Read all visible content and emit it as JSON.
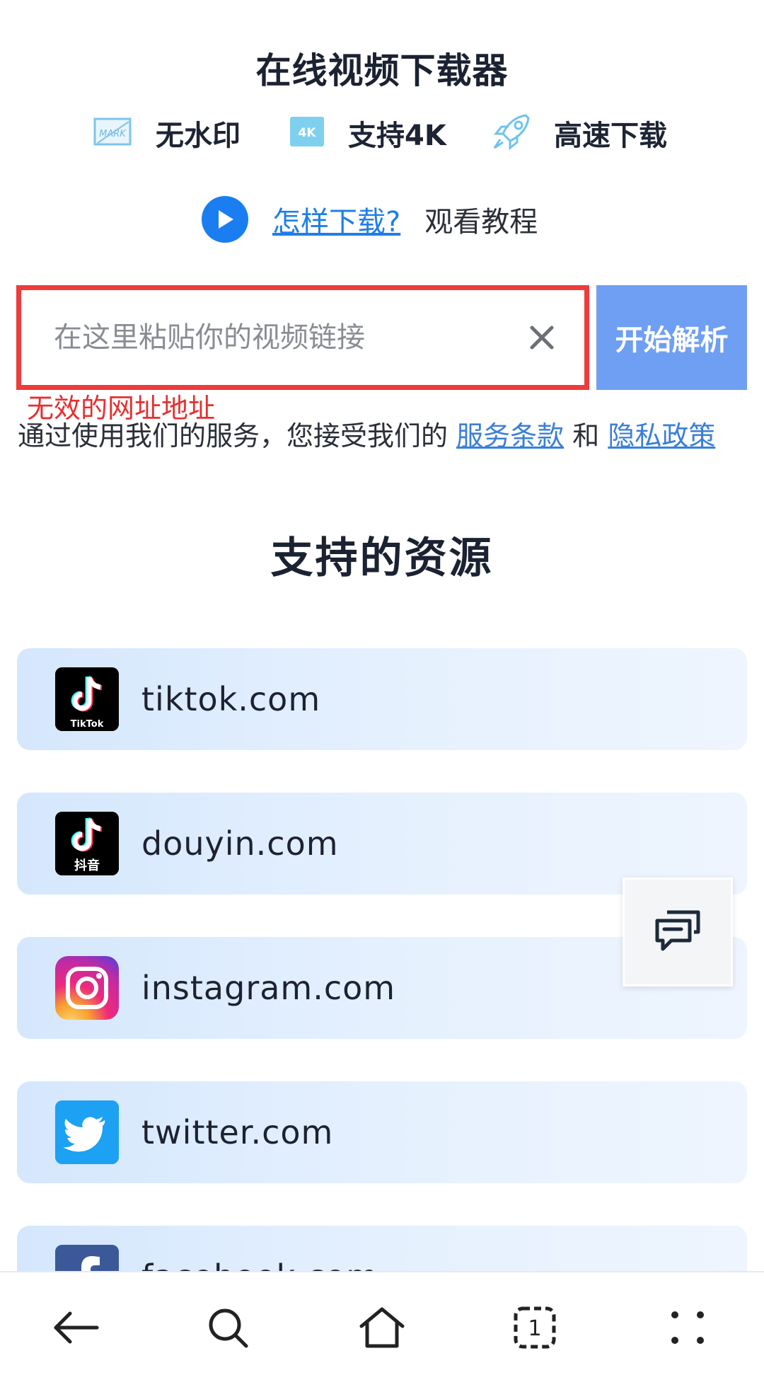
{
  "header": {
    "title": "在线视频下载器"
  },
  "features": [
    {
      "icon": "watermark-icon",
      "label": "无水印"
    },
    {
      "icon": "4k-icon",
      "label": "支持4K"
    },
    {
      "icon": "rocket-icon",
      "label": "高速下载"
    }
  ],
  "howto": {
    "link_text": "怎样下载?",
    "suffix_text": "观看教程"
  },
  "search": {
    "placeholder": "在这里粘贴你的视频链接",
    "value": "",
    "button_label": "开始解析"
  },
  "error_text": "无效的网址地址",
  "terms": {
    "prefix": "通过使用我们的服务，您接受我们的",
    "service_link": "服务条款",
    "conjunction": "和",
    "privacy_link": "隐私政策"
  },
  "sources": {
    "title": "支持的资源",
    "items": [
      {
        "name": "tiktok.com",
        "icon": "tiktok-icon",
        "logo_text": "TikTok"
      },
      {
        "name": "douyin.com",
        "icon": "douyin-icon",
        "logo_text": "抖音"
      },
      {
        "name": "instagram.com",
        "icon": "instagram-icon"
      },
      {
        "name": "twitter.com",
        "icon": "twitter-icon"
      },
      {
        "name": "facebook.com",
        "icon": "facebook-icon"
      }
    ]
  },
  "bottom_nav": {
    "items": [
      "back-icon",
      "search-icon",
      "home-icon",
      "tabs-icon",
      "menu-icon"
    ],
    "tab_count": "1"
  },
  "colors": {
    "accent": "#1a7ef0",
    "button": "#6f9ff3",
    "error": "#e53030",
    "card": "#e6f1fe"
  }
}
